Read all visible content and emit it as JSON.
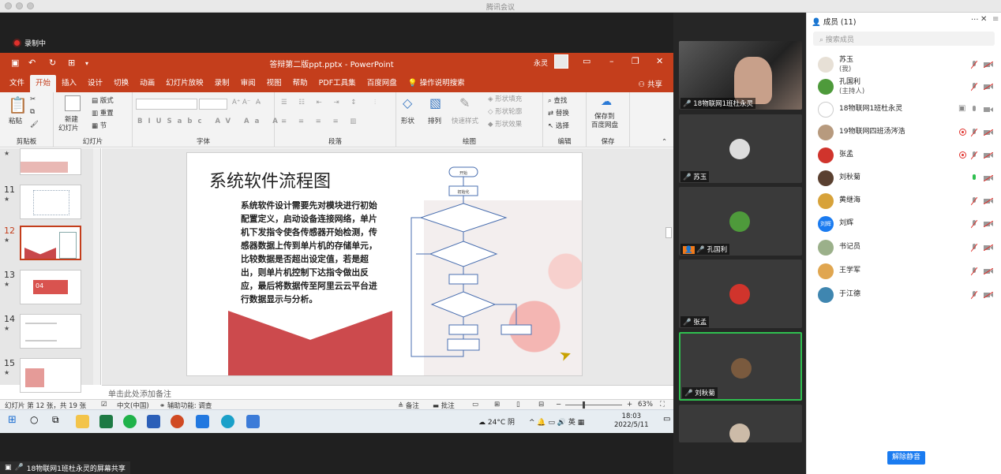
{
  "window": {
    "title": "腾讯会议"
  },
  "recording": {
    "label": "录制中"
  },
  "ppt": {
    "title": "答辩第二版ppt.pptx - PowerPoint",
    "user": "永灵",
    "tabs": [
      "文件",
      "开始",
      "插入",
      "设计",
      "切换",
      "动画",
      "幻灯片放映",
      "录制",
      "审阅",
      "视图",
      "帮助",
      "PDF工具集",
      "百度网盘",
      "操作说明搜索"
    ],
    "share": "共享",
    "ribbon": {
      "clipboard": {
        "paste": "粘贴",
        "label": "剪贴板"
      },
      "slides": {
        "new": "新建",
        "new2": "幻灯片",
        "layout": "版式",
        "reset": "重置",
        "section": "节",
        "label": "幻灯片"
      },
      "font": {
        "label": "字体"
      },
      "paragraph": {
        "label": "段落"
      },
      "drawing": {
        "shape": "形状",
        "arrange": "排列",
        "quick": "快速样式",
        "fill": "形状填充",
        "outline": "形状轮廓",
        "effect": "形状效果",
        "label": "绘图"
      },
      "editing": {
        "find": "查找",
        "replace": "替换",
        "select": "选择",
        "label": "编辑"
      },
      "save": {
        "l1": "保存到",
        "l2": "百度网盘",
        "label": "保存"
      }
    },
    "thumbs": [
      {
        "n": "11"
      },
      {
        "n": "12"
      },
      {
        "n": "13"
      },
      {
        "n": "14"
      },
      {
        "n": "15"
      }
    ],
    "thumb13_text": "04",
    "slide": {
      "title": "系统软件流程图",
      "body": "系统软件设计需要先对模块进行初始配置定义，启动设备连接网络，单片机下发指令使各传感器开始检测，传感器数据上传到单片机的存储单元，比较数据是否超出设定值，若是超出，则单片机控制下达指令做出反应，最后将数据传至阿里云云平台进行数据显示与分析。",
      "flow": {
        "start": "开始",
        "init": "初始化"
      }
    },
    "notes": "单击此处添加备注",
    "status": {
      "slide": "幻灯片 第 12 张，共 19 张",
      "lang": "中文(中国)",
      "access": "辅助功能: 调查",
      "notes": "备注",
      "comments": "批注",
      "zoom": "63%"
    }
  },
  "taskbar": {
    "weather": "24°C 阴",
    "ime": "英",
    "date": "2022/5/11",
    "time": "18:03"
  },
  "share_label": "18物联网1班杜永灵的屏幕共享",
  "videos": [
    {
      "name": "18物联网1班杜永灵"
    },
    {
      "name": "苏玉"
    },
    {
      "name": "孔国利"
    },
    {
      "name": "张孟"
    },
    {
      "name": "刘秋菊"
    }
  ],
  "members": {
    "title": "成员 (11)",
    "search_placeholder": "搜索成员",
    "list": [
      {
        "name": "苏玉",
        "sub": "(我)"
      },
      {
        "name": "孔国利",
        "sub": "(主持人)"
      },
      {
        "name": "18物联网1班杜永灵"
      },
      {
        "name": "19物联网四班汤涔浩"
      },
      {
        "name": "张孟"
      },
      {
        "name": "刘秋菊"
      },
      {
        "name": "黄继海"
      },
      {
        "name": "刘辉",
        "avatar_text": "刘辉"
      },
      {
        "name": "书记员"
      },
      {
        "name": "王学军"
      },
      {
        "name": "于江德"
      }
    ],
    "unmute": "解除静音"
  },
  "colors": {
    "ppt_red": "#c43e1c",
    "accent_blue": "#1a7bf0",
    "active_green": "#2fbf4f"
  }
}
